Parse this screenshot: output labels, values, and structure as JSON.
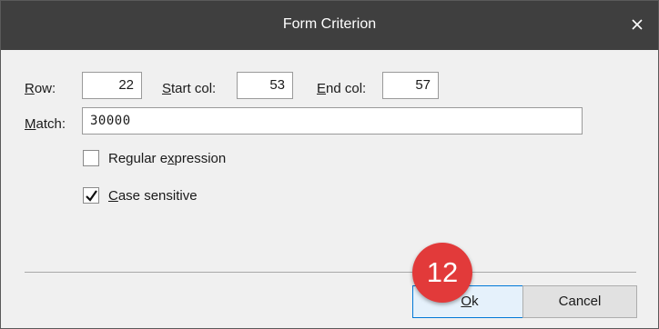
{
  "window": {
    "title": "Form Criterion"
  },
  "fields": {
    "row": {
      "label_accel": "R",
      "label_rest": "ow:",
      "value": "22"
    },
    "start_col": {
      "label_accel": "S",
      "label_rest": "tart col:",
      "value": "53"
    },
    "end_col": {
      "label_accel": "E",
      "label_rest": "nd col:",
      "value": "57"
    },
    "match": {
      "label_accel": "M",
      "label_rest": "atch:",
      "value": "30000"
    }
  },
  "options": {
    "regex": {
      "label_pre": "Regular e",
      "label_accel": "x",
      "label_post": "pression",
      "checked": false
    },
    "case": {
      "label_accel": "C",
      "label_rest": "ase sensitive",
      "checked": true
    }
  },
  "buttons": {
    "ok": {
      "label_accel": "O",
      "label_rest": "k"
    },
    "cancel": {
      "label": "Cancel"
    }
  },
  "annotation": {
    "step": "12",
    "color": "#e23a3a"
  },
  "icons": {
    "close": "close-icon",
    "check": "checkmark-icon"
  }
}
